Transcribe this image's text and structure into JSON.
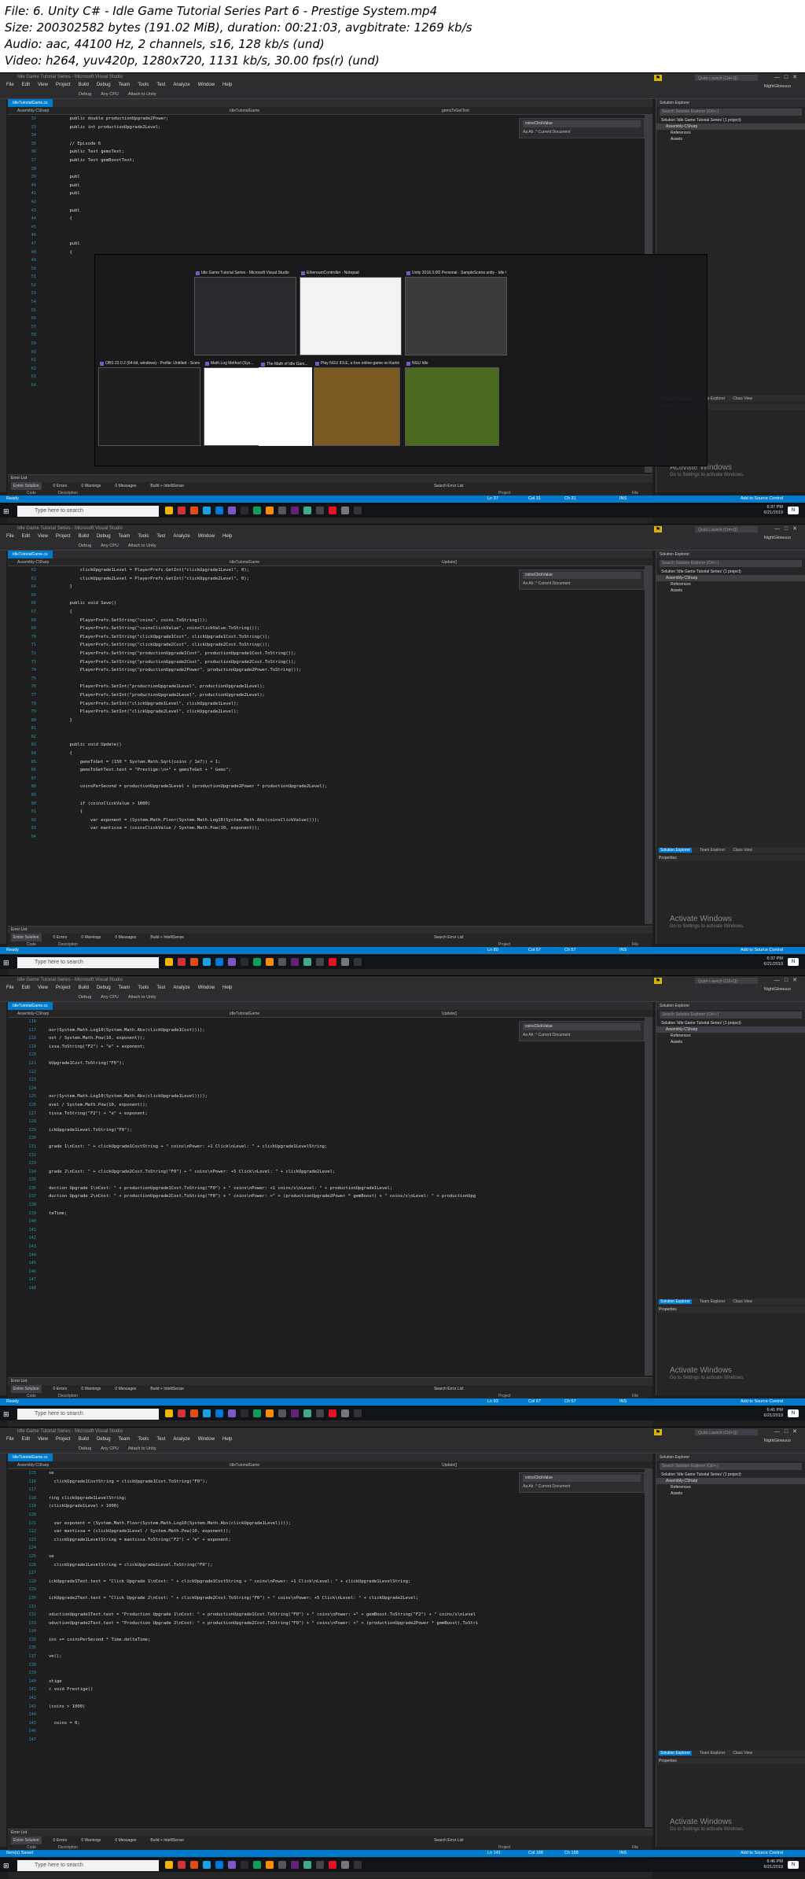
{
  "file_info": {
    "file": "File: 6. Unity C# - Idle Game Tutorial Series Part 6 - Prestige System.mp4",
    "size": "Size: 200302582 bytes (191.02 MiB), duration: 00:21:03, avgbitrate: 1269 kb/s",
    "audio": "Audio: aac, 44100 Hz, 2 channels, s16, 128 kb/s (und)",
    "video": "Video: h264, yuv420p, 1280x720, 1131 kb/s, 30.00 fps(r) (und)"
  },
  "vs": {
    "title": "Idle Game Tutorial Series - Microsoft Visual Studio",
    "menu": [
      "File",
      "Edit",
      "View",
      "Project",
      "Build",
      "Debug",
      "Team",
      "Tools",
      "Test",
      "Analyze",
      "Window",
      "Help"
    ],
    "toolbar": [
      "Debug",
      "Any CPU",
      "Attach to Unity"
    ],
    "quick_launch": "Quick Launch (Ctrl+Q)",
    "user": "NightGlowuus",
    "tab_file": "IdleTutorialGame.cs",
    "nav_project": "Assembly-CSharp",
    "nav_class": "IdleTutorialGame",
    "find_term": "coinsClickValue",
    "find_scope": "Current Document",
    "solution_explorer": "Solution Explorer",
    "solution_search": "Search Solution Explorer (Ctrl+;)",
    "solution_tree": [
      "Solution 'Idle Game Tutorial Series' (1 project)",
      "Assembly-CSharp",
      "References",
      "Assets"
    ],
    "right_tabs": [
      "Solution Explorer",
      "Team Explorer",
      "Class View"
    ],
    "properties": "Properties",
    "error_list": "Error List",
    "error_scope": "Entire Solution",
    "errors": "0 Errors",
    "warnings": "0 Warnings",
    "messages": "0 Messages",
    "build": "Build + IntelliSense",
    "search_errors": "Search Error List",
    "error_cols": [
      "Code",
      "Description",
      "Project",
      "File"
    ],
    "bottom_tabs": [
      "Error List",
      "Package Manager Console",
      "Output"
    ],
    "activate_title": "Activate Windows",
    "activate_sub": "Go to Settings to activate Windows.",
    "add_source": "Add to Source Control",
    "taskbar_search": "Type here to search"
  },
  "frames": [
    {
      "status_left": "Ready",
      "ln": "Ln 37",
      "col": "Col 31",
      "ch": "Ch 31",
      "ins": "INS",
      "nav_member": "gemsToGetText",
      "gutter": [
        "32",
        "33",
        "34",
        "35",
        "36",
        "37",
        "38",
        "39",
        "40",
        "41",
        "42",
        "43",
        "44",
        "45",
        "46",
        "47",
        "48",
        "49",
        "50",
        "51",
        "52",
        "53",
        "54",
        "55",
        "56",
        "57",
        "58",
        "59",
        "60",
        "61",
        "62",
        "63",
        "64"
      ],
      "code": [
        "        public double productionUpgrade2Power;",
        "        public int productionUpgrade2Level;",
        "",
        "        // Episode 6",
        "        public Text gemsText;",
        "        public Text gemBoostText;",
        "",
        "        publ",
        "        publ",
        "        publ",
        "",
        "        publ",
        "        {",
        "",
        "",
        "        publ",
        "        {",
        "",
        "",
        "",
        "",
        "",
        "",
        "",
        "",
        "",
        "",
        "",
        "",
        "",
        "",
        "",
        ""
      ],
      "switcher": [
        {
          "cap": "Idle Game Tutorial Series - Microsoft Visual Studio"
        },
        {
          "cap": "EthereumController - Notepad"
        },
        {
          "cap": "Unity 2018.3.0f2 Personal - SampleScene.unity - Idle Game..."
        },
        {
          "cap": "OBS 22.0.2 (64-bit, windows) - Profile: Untitled - Scenes: U..."
        },
        {
          "cap": "Math.Log Method (Sys..."
        },
        {
          "cap": "The Math of Idle Gam..."
        },
        {
          "cap": "Play NGU IDLE, a free online game on Kartridge -- Kartri..."
        },
        {
          "cap": "NGU Idle"
        }
      ],
      "clock": [
        "6:37 PM",
        "6/21/2019"
      ]
    },
    {
      "status_left": "Ready",
      "ln": "Ln 80",
      "col": "Col 67",
      "ch": "Ch 57",
      "ins": "INS",
      "nav_member": "Update()",
      "gutter": [
        "62",
        "63",
        "64",
        "65",
        "66",
        "67",
        "68",
        "69",
        "70",
        "71",
        "72",
        "73",
        "74",
        "75",
        "76",
        "77",
        "78",
        "79",
        "80",
        "81",
        "82",
        "83",
        "84",
        "85",
        "86",
        "87",
        "88",
        "89",
        "90",
        "91",
        "92",
        "93",
        "94"
      ],
      "code": [
        "            clickUpgrade1Level = PlayerPrefs.GetInt(\"clickUpgrade1Level\", 0);",
        "            clickUpgrade2Level = PlayerPrefs.GetInt(\"clickUpgrade2Level\", 0);",
        "        }",
        "",
        "        public void Save()",
        "        {",
        "            PlayerPrefs.SetString(\"coins\", coins.ToString());",
        "            PlayerPrefs.SetString(\"coinsClickValue\", coinsClickValue.ToString());",
        "            PlayerPrefs.SetString(\"clickUpgrade1Cost\", clickUpgrade1Cost.ToString());",
        "            PlayerPrefs.SetString(\"clickUpgrade2Cost\", clickUpgrade2Cost.ToString());",
        "            PlayerPrefs.SetString(\"productionUpgrade1Cost\", productionUpgrade1Cost.ToString());",
        "            PlayerPrefs.SetString(\"productionUpgrade2Cost\", productionUpgrade2Cost.ToString());",
        "            PlayerPrefs.SetString(\"productionUpgrade2Power\", productionUpgrade2Power.ToString());",
        "",
        "            PlayerPrefs.SetInt(\"productionUpgrade1Level\", productionUpgrade1Level);",
        "            PlayerPrefs.SetInt(\"productionUpgrade2Level\", productionUpgrade2Level);",
        "            PlayerPrefs.SetInt(\"clickUpgrade1Level\", clickUpgrade1Level);",
        "            PlayerPrefs.SetInt(\"clickUpgrade2Level\", clickUpgrade2Level);",
        "        }",
        "",
        "",
        "        public void Update()",
        "        {",
        "            gemsToGet = (150 * System.Math.Sqrt(coins / 1e7)) + 1;",
        "            gemsToGetText.text = \"Prestige:\\n+\" + gemsToGet + \" Gems\";",
        "",
        "            coinsPerSecond = productionUpgrade1Level + (productionUpgrade2Power * productionUpgrade2Level);",
        "",
        "            if (coinsClickValue > 1000)",
        "            {",
        "                var exponent = (System.Math.Floor(System.Math.Log10(System.Math.Abs(coinsClickValue))));",
        "                var mantissa = (coinsClickValue / System.Math.Pow(10, exponent));",
        ""
      ],
      "clock": [
        "6:37 PM",
        "6/21/2019"
      ]
    },
    {
      "status_left": "Ready",
      "ln": "Ln 93",
      "col": "Col 67",
      "ch": "Ch 57",
      "ins": "INS",
      "nav_member": "Update()",
      "gutter": [
        "116",
        "117",
        "118",
        "119",
        "120",
        "121",
        "122",
        "123",
        "124",
        "125",
        "126",
        "127",
        "128",
        "129",
        "130",
        "131",
        "132",
        "133",
        "134",
        "135",
        "136",
        "137",
        "138",
        "139",
        "140",
        "141",
        "142",
        "143",
        "144",
        "145",
        "146",
        "147",
        "148"
      ],
      "code": [
        "",
        "oor(System.Math.Log10(System.Math.Abs(clickUpgrade1Cost))));",
        "ost / System.Math.Pow(10, exponent));",
        "issa.ToString(\"F2\") + \"e\" + exponent;",
        "",
        "kUpgrade1Cost.ToString(\"F0\");",
        "",
        "",
        "",
        "oor(System.Math.Log10(System.Math.Abs(clickUpgrade1Level))));",
        "evel / System.Math.Pow(10, exponent));",
        "tissa.ToString(\"F2\") + \"e\" + exponent;",
        "",
        "ickUpgrade1Level.ToString(\"F0\");",
        "",
        "grade 1\\nCost: \" + clickUpgrade1CostString + \" coins\\nPower: +1 Click\\nLevel: \" + clickUpgrade1LevelString;",
        "",
        "",
        "grade 2\\nCost: \" + clickUpgrade2Cost.ToString(\"F0\") + \" coins\\nPower: +5 Click\\nLevel: \" + clickUpgrade2Level;",
        "",
        "duction Upgrade 1\\nCost: \" + productionUpgrade1Cost.ToString(\"F0\") + \" coins\\nPower: +1 coins/s\\nLevel: \" + productionUpgrade1Level;",
        "duction Upgrade 2\\nCost: \" + productionUpgrade2Cost.ToString(\"F0\") + \" coins\\nPower: +\" + (productionUpgrade2Power * gemBoost) + \" coins/s\\nLevel: \" + productionUpg",
        "",
        "taTime;",
        "",
        "",
        "",
        "",
        "",
        "",
        "",
        "",
        ""
      ],
      "clock": [
        "6:41 PM",
        "6/21/2019"
      ]
    },
    {
      "status_left": "Item(s) Saved",
      "ln": "Ln 141",
      "col": "Col 168",
      "ch": "Ch 158",
      "ins": "INS",
      "nav_member": "Update()",
      "gutter": [
        "115",
        "116",
        "117",
        "118",
        "119",
        "120",
        "121",
        "122",
        "123",
        "124",
        "125",
        "126",
        "127",
        "128",
        "129",
        "130",
        "131",
        "132",
        "133",
        "134",
        "135",
        "136",
        "137",
        "138",
        "139",
        "140",
        "141",
        "142",
        "143",
        "144",
        "145",
        "146",
        "147"
      ],
      "code": [
        "se",
        "  clickUpgrade1CostString = clickUpgrade1Cost.ToString(\"F0\");",
        "",
        "ring clickUpgrade1LevelString;",
        "(clickUpgrade1Level > 1000)",
        "",
        "  var exponent = (System.Math.Floor(System.Math.Log10(System.Math.Abs(clickUpgrade1Level))));",
        "  var mantissa = (clickUpgrade1Level / System.Math.Pow(10, exponent));",
        "  clickUpgrade1LevelString = mantissa.ToString(\"F2\") + \"e\" + exponent;",
        "",
        "se",
        "  clickUpgrade1LevelString = clickUpgrade1Level.ToString(\"F0\");",
        "",
        "ickUpgrade1Text.text = \"Click Upgrade 1\\nCost: \" + clickUpgrade1CostString + \" coins\\nPower: +1 Click\\nLevel: \" + clickUpgrade1LevelString;",
        "",
        "ickUpgrade2Text.text = \"Click Upgrade 2\\nCost: \" + clickUpgrade2Cost.ToString(\"F0\") + \" coins\\nPower: +5 Click\\nLevel: \" + clickUpgrade2Level;",
        "",
        "oductionUpgrade1Text.text = \"Production Upgrade 1\\nCost: \" + productionUpgrade1Cost.ToString(\"F0\") + \" coins\\nPower: +\" + gemBoost.ToString(\"F2\") + \" coins/s\\nLevel",
        "oductionUpgrade2Text.text = \"Production Upgrade 2\\nCost: \" + productionUpgrade2Cost.ToString(\"F0\") + \" coins\\nPower: +\" + (productionUpgrade2Power * gemBoost).ToStri",
        "",
        "ins += coinsPerSecond * Time.deltaTime;",
        "",
        "ve();",
        "",
        "",
        "stige",
        "c void Prestige()",
        "",
        "(coins > 1000)",
        "",
        "  coins = 0;",
        "",
        ""
      ],
      "clock": [
        "6:46 PM",
        "6/21/2019"
      ]
    }
  ]
}
